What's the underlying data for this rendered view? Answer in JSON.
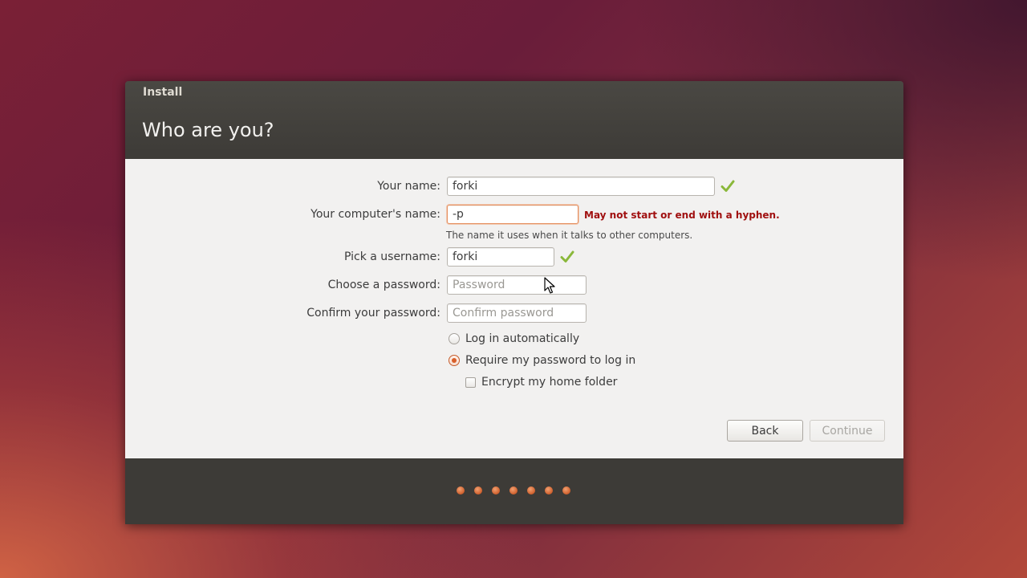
{
  "window": {
    "app_title": "Install",
    "page_title": "Who are you?"
  },
  "form": {
    "name": {
      "label": "Your name:",
      "value": "forki",
      "valid_icon": "check-icon"
    },
    "computer_name": {
      "label": "Your computer's name:",
      "value": "-p",
      "error": "May not start or end with a hyphen.",
      "hint": "The name it uses when it talks to other computers."
    },
    "username": {
      "label": "Pick a username:",
      "value": "forki",
      "valid_icon": "check-icon"
    },
    "password": {
      "label": "Choose a password:",
      "value": "",
      "placeholder": "Password"
    },
    "confirm_password": {
      "label": "Confirm your password:",
      "value": "",
      "placeholder": "Confirm password"
    },
    "login_options": [
      {
        "label": "Log in automatically",
        "selected": false
      },
      {
        "label": "Require my password to log in",
        "selected": true
      }
    ],
    "encrypt": {
      "label": "Encrypt my home folder",
      "checked": false
    }
  },
  "buttons": {
    "back": "Back",
    "continue": "Continue",
    "continue_enabled": false
  },
  "progress": {
    "steps": 7
  },
  "colors": {
    "accent": "#d85f2a",
    "error": "#a01010",
    "valid": "#8ab83a",
    "header_bg": "#3d3b37",
    "content_bg": "#f2f1f0"
  }
}
